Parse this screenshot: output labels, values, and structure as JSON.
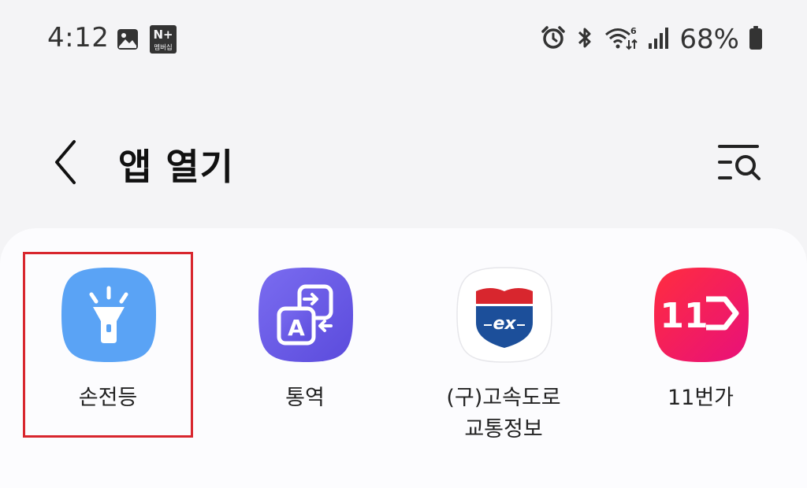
{
  "status_bar": {
    "time": "4:12",
    "nplus_badge": "N+",
    "nplus_sub": "멤버십",
    "battery_percent": "68%",
    "icons": [
      "gallery-icon",
      "nplus-icon",
      "alarm-icon",
      "bluetooth-icon",
      "wifi-6-icon",
      "signal-icon",
      "battery-icon"
    ]
  },
  "header": {
    "title": "앱 열기",
    "back_icon": "chevron-left-icon",
    "search_icon": "list-search-icon"
  },
  "apps": [
    {
      "label": "손전등",
      "icon": "flashlight-icon",
      "color": "#5aa3f5",
      "selected": true
    },
    {
      "label": "통역",
      "icon": "interpreter-icon",
      "color": "#6a5ae8"
    },
    {
      "label": "(구)고속도로\n교통정보",
      "icon": "expressway-icon",
      "color": "#ffffff"
    },
    {
      "label": "11번가",
      "icon": "11st-icon",
      "logo_text": "11",
      "color": "#f0204a"
    }
  ],
  "colors": {
    "highlight": "#d8262e",
    "background": "#f4f4f6",
    "panel": "#fcfcfe"
  }
}
